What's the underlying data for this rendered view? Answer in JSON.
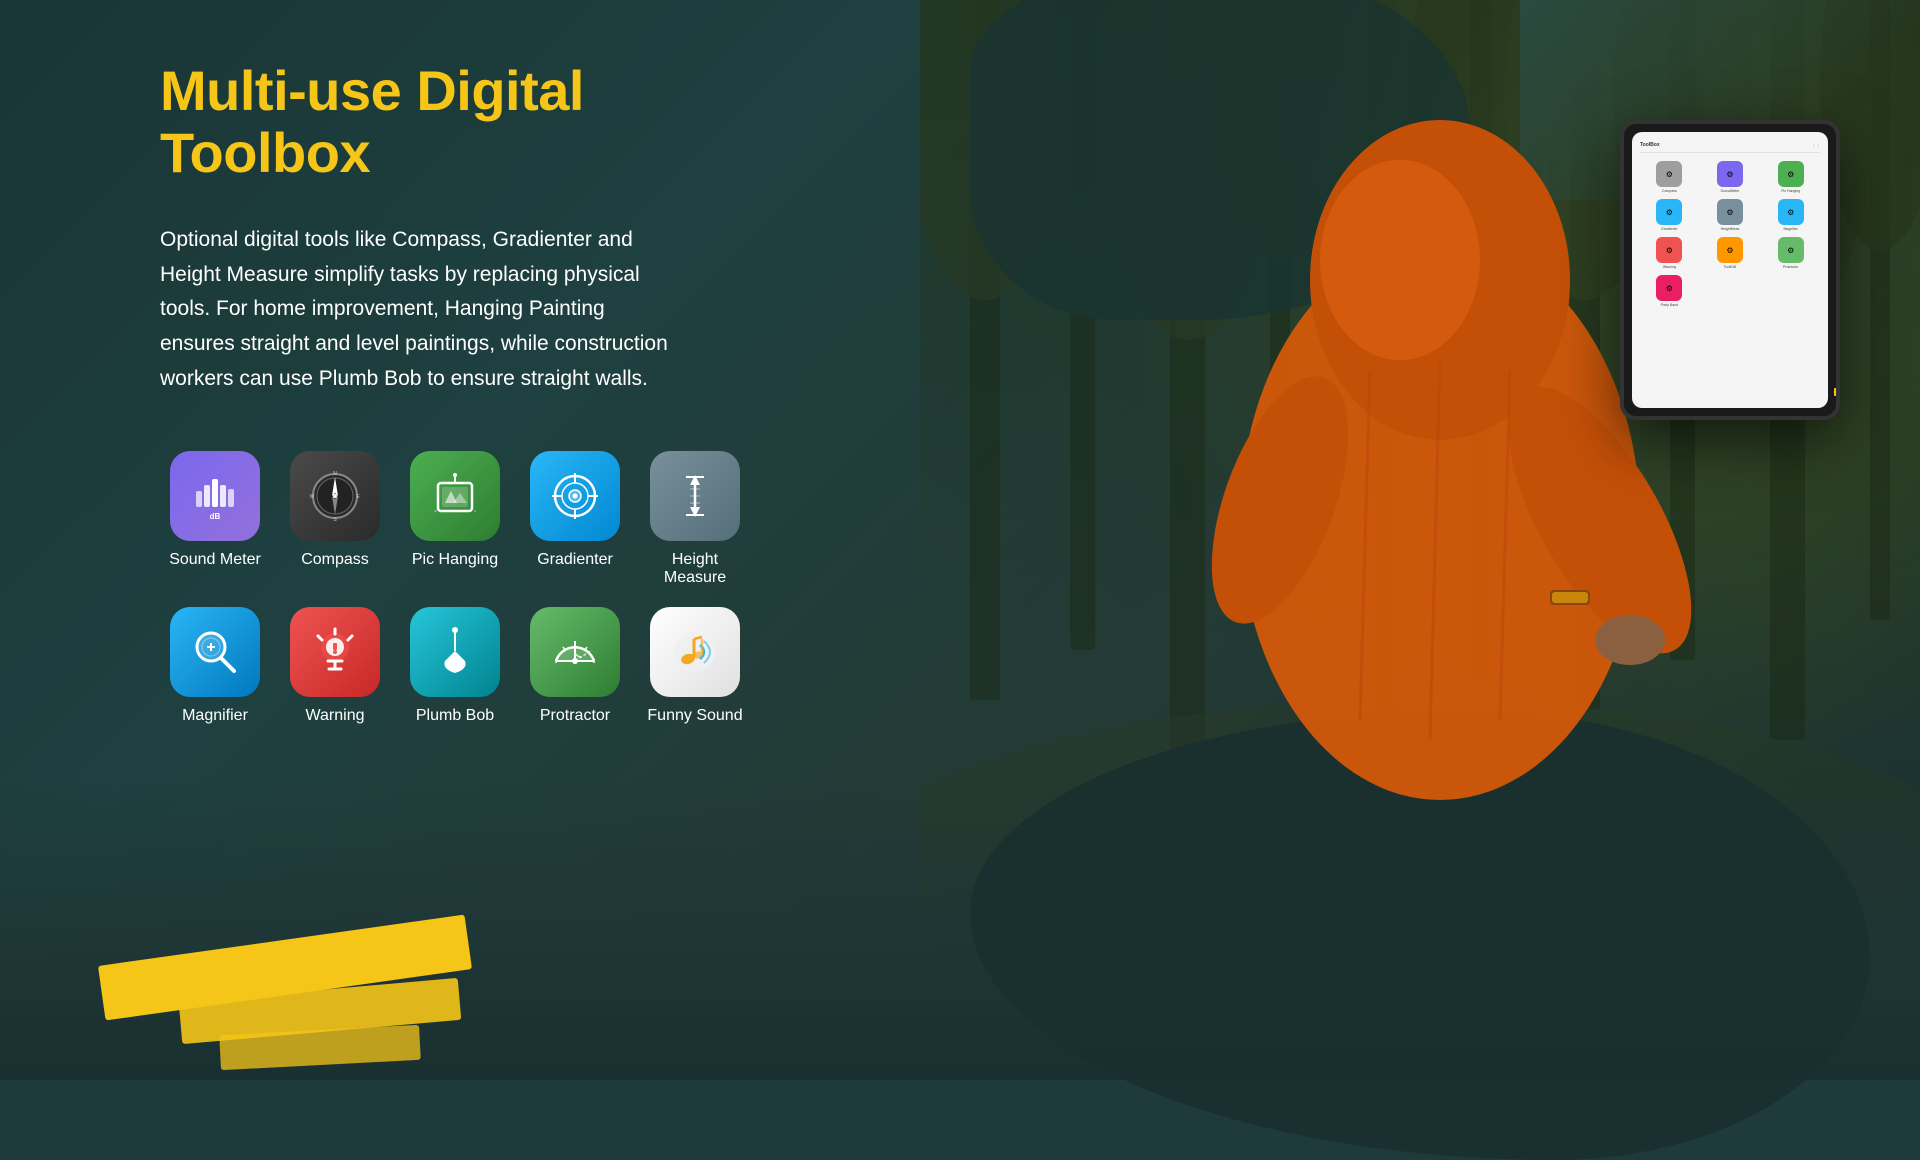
{
  "page": {
    "title": "Multi-use Digital Toolbox",
    "description": "Optional digital tools like Compass, Gradienter and Height Measure simplify tasks by replacing physical tools. For home improvement, Hanging Painting ensures straight and level paintings, while construction workers can use Plumb Bob to ensure straight walls."
  },
  "apps": {
    "row1": [
      {
        "id": "sound-meter",
        "label": "Sound Meter",
        "color1": "#7b68ee",
        "color2": "#9370db"
      },
      {
        "id": "compass",
        "label": "Compass",
        "color1": "#4a4a4a",
        "color2": "#2a2a2a"
      },
      {
        "id": "pic-hanging",
        "label": "Pic Hanging",
        "color1": "#4caf50",
        "color2": "#2e7d32"
      },
      {
        "id": "gradienter",
        "label": "Gradienter",
        "color1": "#29b6f6",
        "color2": "#0288d1"
      },
      {
        "id": "height-measure",
        "label": "Height Measure",
        "color1": "#78909c",
        "color2": "#546e7a"
      }
    ],
    "row2": [
      {
        "id": "magnifier",
        "label": "Magnifier",
        "color1": "#29b6f6",
        "color2": "#0277bd"
      },
      {
        "id": "warning",
        "label": "Warning",
        "color1": "#ef5350",
        "color2": "#c62828"
      },
      {
        "id": "plumb-bob",
        "label": "Plumb Bob",
        "color1": "#26c6da",
        "color2": "#00838f"
      },
      {
        "id": "protractor",
        "label": "Protractor",
        "color1": "#66bb6a",
        "color2": "#2e7d32"
      },
      {
        "id": "funny-sound",
        "label": "Funny Sound",
        "color1": "#ffffff",
        "color2": "#e0e0e0"
      }
    ]
  },
  "tablet": {
    "toolbar_label": "ToolBox",
    "apps": [
      {
        "label": "Compass",
        "bg": "#9e9e9e"
      },
      {
        "label": "SoundMeter",
        "bg": "#7b68ee"
      },
      {
        "label": "Pic Hanging",
        "bg": "#4caf50"
      },
      {
        "label": "Gradienter",
        "bg": "#29b6f6"
      },
      {
        "label": "HeightMeas",
        "bg": "#78909c"
      },
      {
        "label": "Magnifier",
        "bg": "#29b6f6"
      },
      {
        "label": "Warning",
        "bg": "#ef5350"
      },
      {
        "label": "ToolEdit",
        "bg": "#ff9800"
      },
      {
        "label": "Protractor",
        "bg": "#66bb6a"
      },
      {
        "label": "Party Band",
        "bg": "#e91e63"
      }
    ]
  }
}
